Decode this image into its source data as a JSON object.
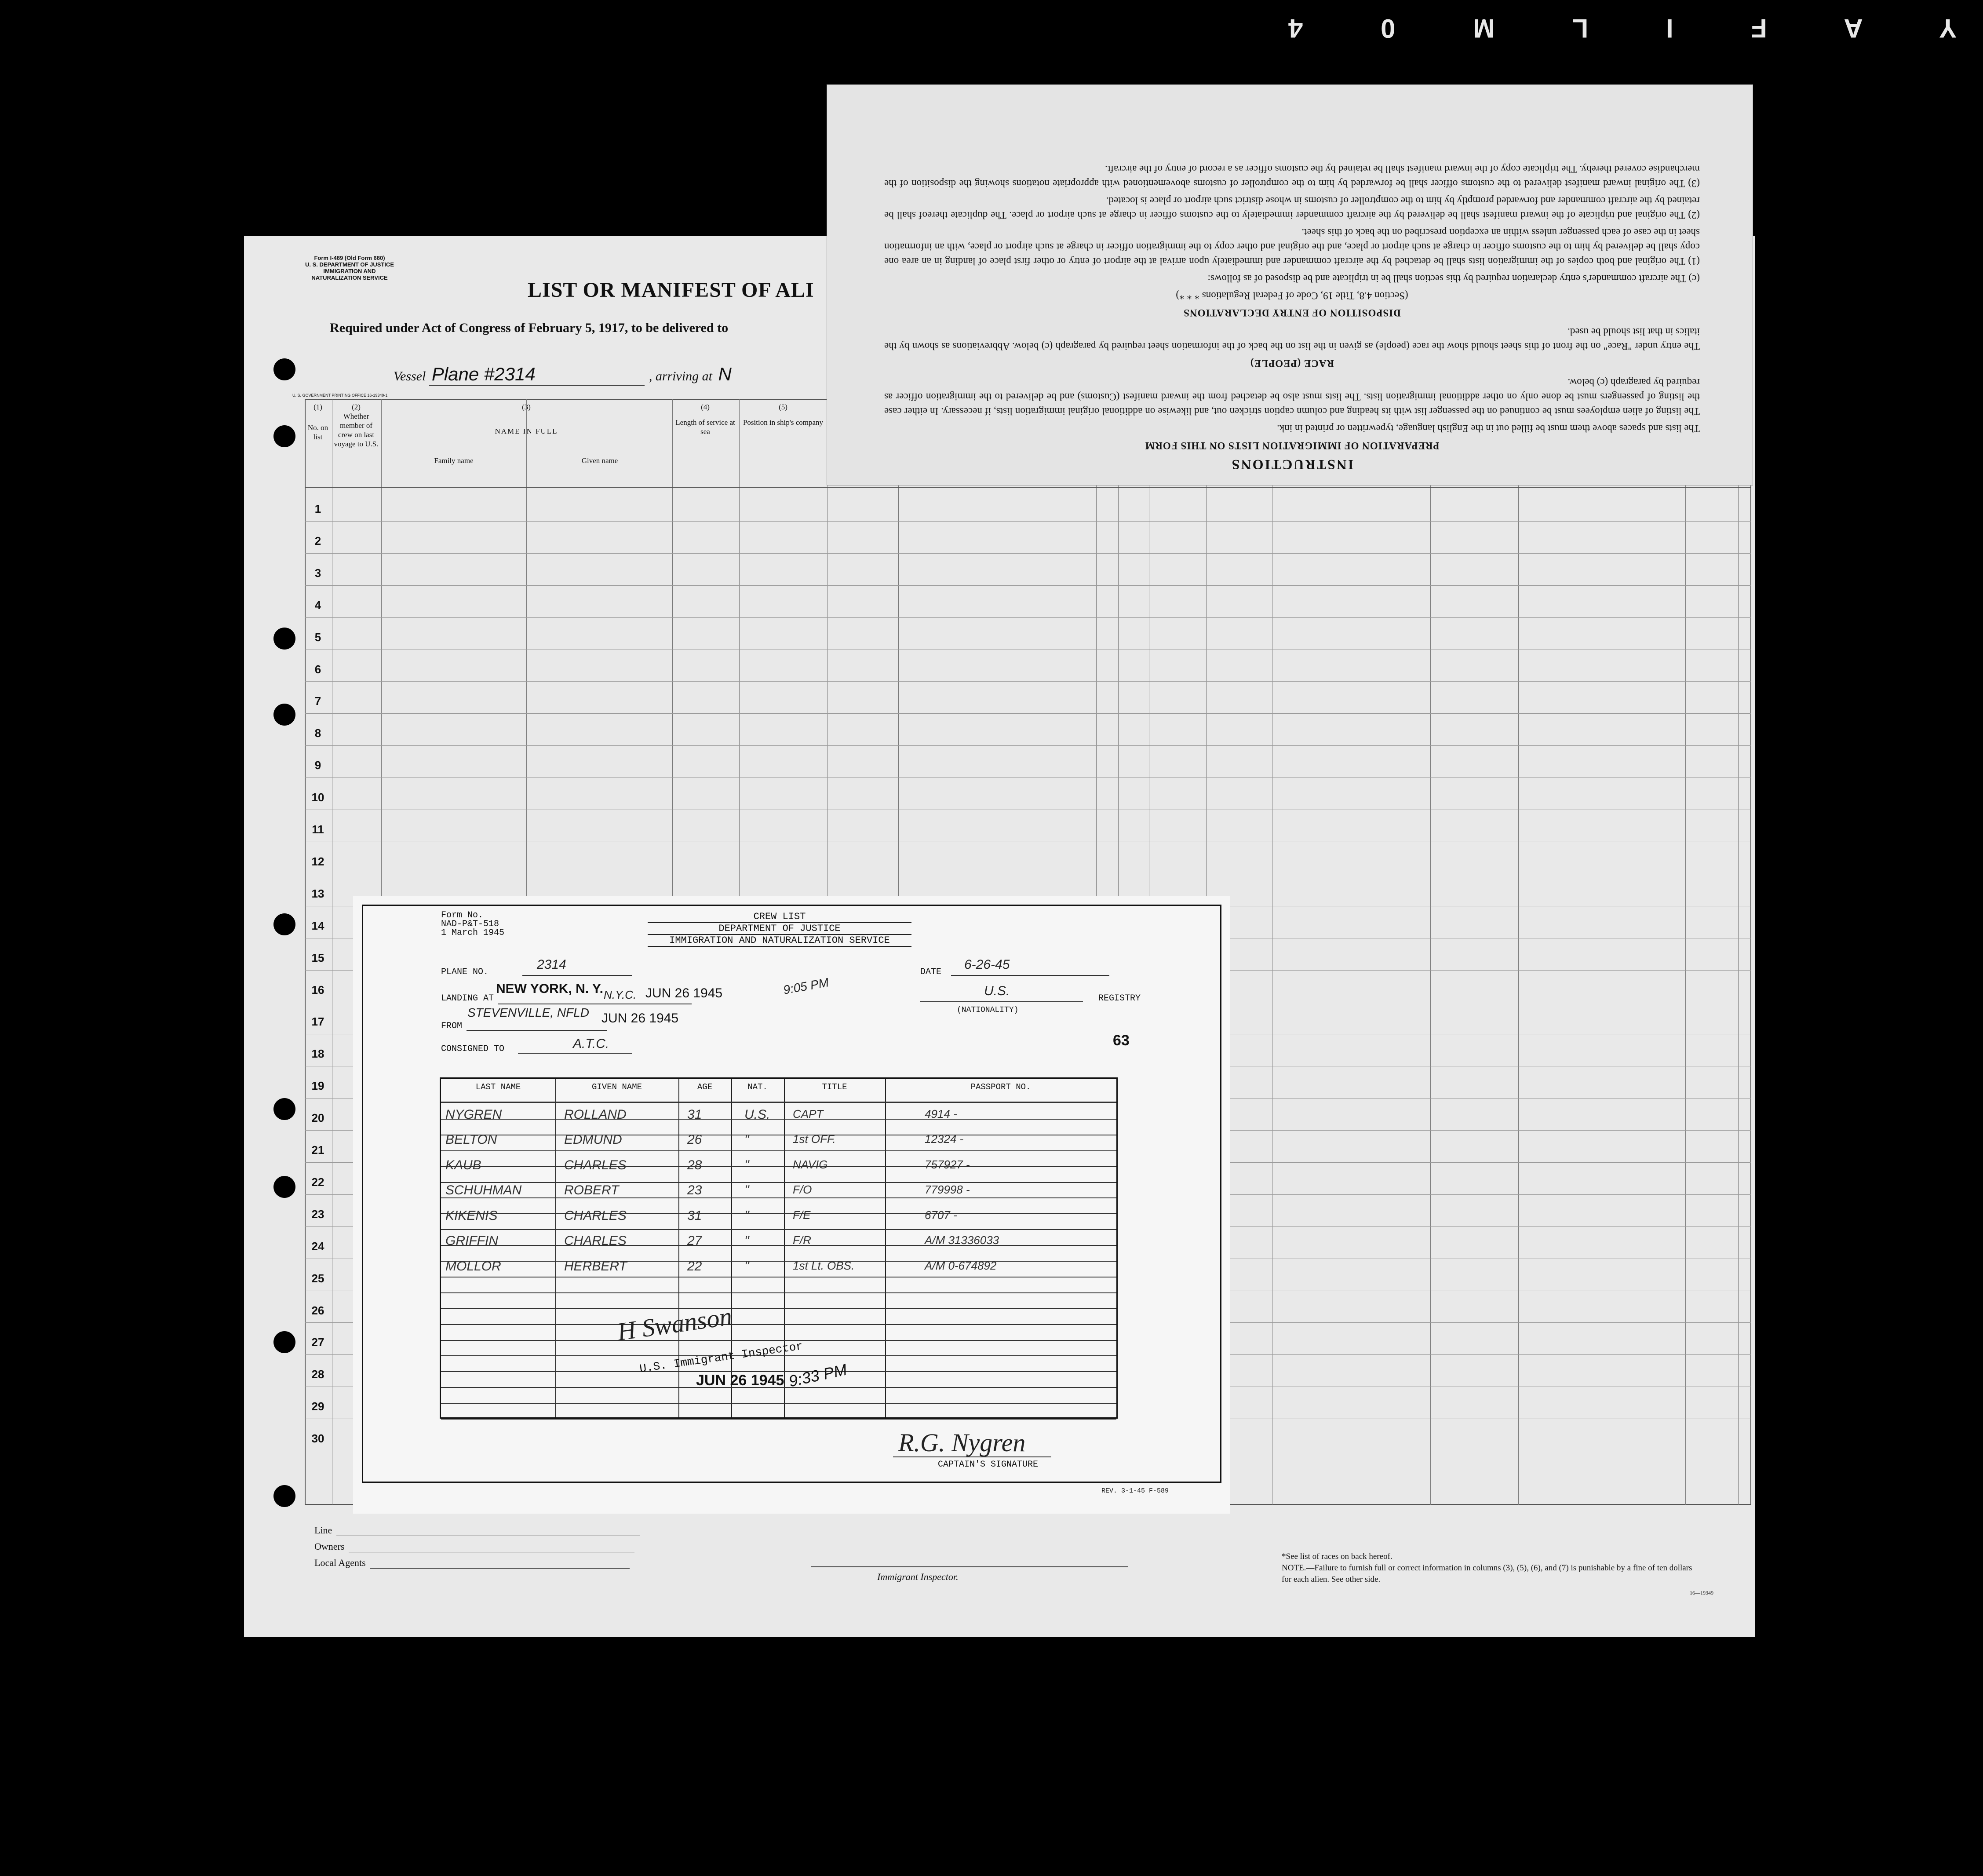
{
  "reel_label": "Y A F I L M 0 4",
  "manifest": {
    "form_id": [
      "Form I-489 (Old Form 680)",
      "U. S. DEPARTMENT OF JUSTICE",
      "IMMIGRATION AND NATURALIZATION SERVICE"
    ],
    "title": "LIST OR MANIFEST OF ALI",
    "subtitle": "Required under Act of Congress of February 5, 1917, to be delivered to",
    "vessel_label": "Vessel",
    "vessel_value": "Plane #2314",
    "arriving_label": ", arriving at",
    "arriving_value": "N",
    "gpo": "U. S. GOVERNMENT PRINTING OFFICE   16-19349-1",
    "columns": [
      {
        "num": "(1)",
        "label": "No. on list"
      },
      {
        "num": "(2)",
        "label": "Whether member of crew on last voyage to U.S."
      },
      {
        "num": "(3)",
        "label": "NAME IN FULL"
      },
      {
        "num": "(4)",
        "label": "Length of service at sea"
      },
      {
        "num": "(5)",
        "label": "Position in ship's company"
      }
    ],
    "name_sub": {
      "family": "Family name",
      "given": "Given name"
    },
    "rows": [
      "1",
      "2",
      "3",
      "4",
      "5",
      "6",
      "7",
      "8",
      "9",
      "10",
      "11",
      "12",
      "13",
      "14",
      "15",
      "16",
      "17",
      "18",
      "19",
      "20",
      "21",
      "22",
      "23",
      "24",
      "25",
      "26",
      "27",
      "28",
      "29",
      "30"
    ],
    "footer": {
      "line": "Line",
      "owners": "Owners",
      "local_agents": "Local Agents",
      "inspector": "Immigrant Inspector.",
      "note1": "*See list of races on back hereof.",
      "note2": "NOTE.—Failure to furnish full or correct information in columns (3), (5), (6), and (7) is punishable by a fine of ten dollars for each alien.  See other side.",
      "code": "16—19349"
    }
  },
  "instructions": {
    "title": "INSTRUCTIONS",
    "section1": "PREPARATION OF IMMIGRATION LISTS ON THIS FORM",
    "p1": "The lists and spaces above them must be filled out in the English language, typewritten or printed in ink.",
    "p2": "The listing of alien employees must be continued on the passenger list with its heading and column caption stricken out, and likewise on additional original immigration lists, if necessary. In either case the listing of passengers must be done only on other additional immigration lists. The lists must also be detached from the inward manifest (Customs) and be delivered to the immigration officer as required by paragraph (c) below.",
    "section2": "RACE (PEOPLE)",
    "p3": "The entry under \"Race\" on the front of this sheet should show the race (people) as given in the list on the back of the information sheet required by paragraph (c) below. Abbreviations as shown by the italics in that list should be used.",
    "section3": "DISPOSITION OF ENTRY DECLARATIONS",
    "p4": "(Section 4.8, Title 19, Code of Federal Regulations * * *)",
    "p5": "(c) The aircraft commander's entry declaration required by this section shall be in triplicate and be disposed of as follows:",
    "p6": "(1) The original and both copies of the immigration lists shall be detached by the aircraft commander and immediately upon arrival at the airport of entry or other first place of landing in an area one copy shall be delivered by him to the customs officer in charge at such airport or place, and the original and other copy to the immigration officer in charge at such airport or place, with an information sheet in the case of each passenger unless within an exception prescribed on the back of this sheet.",
    "p7": "(2) The original and triplicate of the inward manifest shall be delivered by the aircraft commander immediately to the customs officer in charge at such airport or place. The duplicate thereof shall be retained by the aircraft commander and forwarded promptly by him to the comptroller of customs in whose district such airport or place is located.",
    "p8": "(3) The original inward manifest delivered to the customs officer shall be forwarded by him to the comptroller of customs abovementioned with appropriate notations showing the disposition of the merchandise covered thereby. The triplicate copy of the inward manifest shall be retained by the customs officer as a record of entry of the aircraft."
  },
  "crew_list": {
    "form": [
      "Form No.",
      "NAD-P&T-518",
      "1 March 1945"
    ],
    "heading": [
      "CREW LIST",
      "DEPARTMENT OF JUSTICE",
      "IMMIGRATION AND NATURALIZATION SERVICE"
    ],
    "plane_no_label": "PLANE NO.",
    "plane_no": "2314",
    "date_label": "DATE",
    "date": "6-26-45",
    "landing_label": "LANDING AT",
    "landing_stamp": "NEW YORK, N. Y.",
    "landing_hand": "N.Y.C.",
    "landing_date_stamp": "JUN 26 1945",
    "landing_time": "9:05 PM",
    "registry_value": "U.S.",
    "registry_label": "REGISTRY",
    "nationality_label": "(NATIONALITY)",
    "from_label": "FROM",
    "from_value": "STEVENVILLE, NFLD",
    "from_date_stamp": "JUN 26 1945",
    "consigned_label": "CONSIGNED TO",
    "consigned_value": "A.T.C.",
    "sheet_number": "63",
    "columns": [
      "LAST NAME",
      "GIVEN NAME",
      "AGE",
      "NAT.",
      "TITLE",
      "PASSPORT NO."
    ],
    "rows": [
      {
        "last": "NYGREN",
        "given": "ROLLAND",
        "age": "31",
        "nat": "U.S.",
        "title": "CAPT",
        "passport": "4914 -"
      },
      {
        "last": "BELTON",
        "given": "EDMUND",
        "age": "26",
        "nat": "\"",
        "title": "1st OFF.",
        "passport": "12324 -"
      },
      {
        "last": "KAUB",
        "given": "CHARLES",
        "age": "28",
        "nat": "\"",
        "title": "NAVIG",
        "passport": "757927 -"
      },
      {
        "last": "SCHUHMAN",
        "given": "ROBERT",
        "age": "23",
        "nat": "\"",
        "title": "F/O",
        "passport": "779998 -"
      },
      {
        "last": "KIKENIS",
        "given": "CHARLES",
        "age": "31",
        "nat": "\"",
        "title": "F/E",
        "passport": "6707 -"
      },
      {
        "last": "GRIFFIN",
        "given": "CHARLES",
        "age": "27",
        "nat": "\"",
        "title": "F/R",
        "passport": "A/M 31336033"
      },
      {
        "last": "MOLLOR",
        "given": "HERBERT",
        "age": "22",
        "nat": "\"",
        "title": "1st Lt. OBS.",
        "passport": "A/M 0-674892"
      }
    ],
    "inspector_sig": "H Swanson",
    "inspector_stamp": "U.S. Immigrant Inspector",
    "stamp_date": "JUN 26 1945",
    "stamp_time": "9:33 PM",
    "captain_sig": "R.G. Nygren",
    "captain_label": "CAPTAIN'S SIGNATURE",
    "rev": "REV. 3-1-45 F-589"
  }
}
